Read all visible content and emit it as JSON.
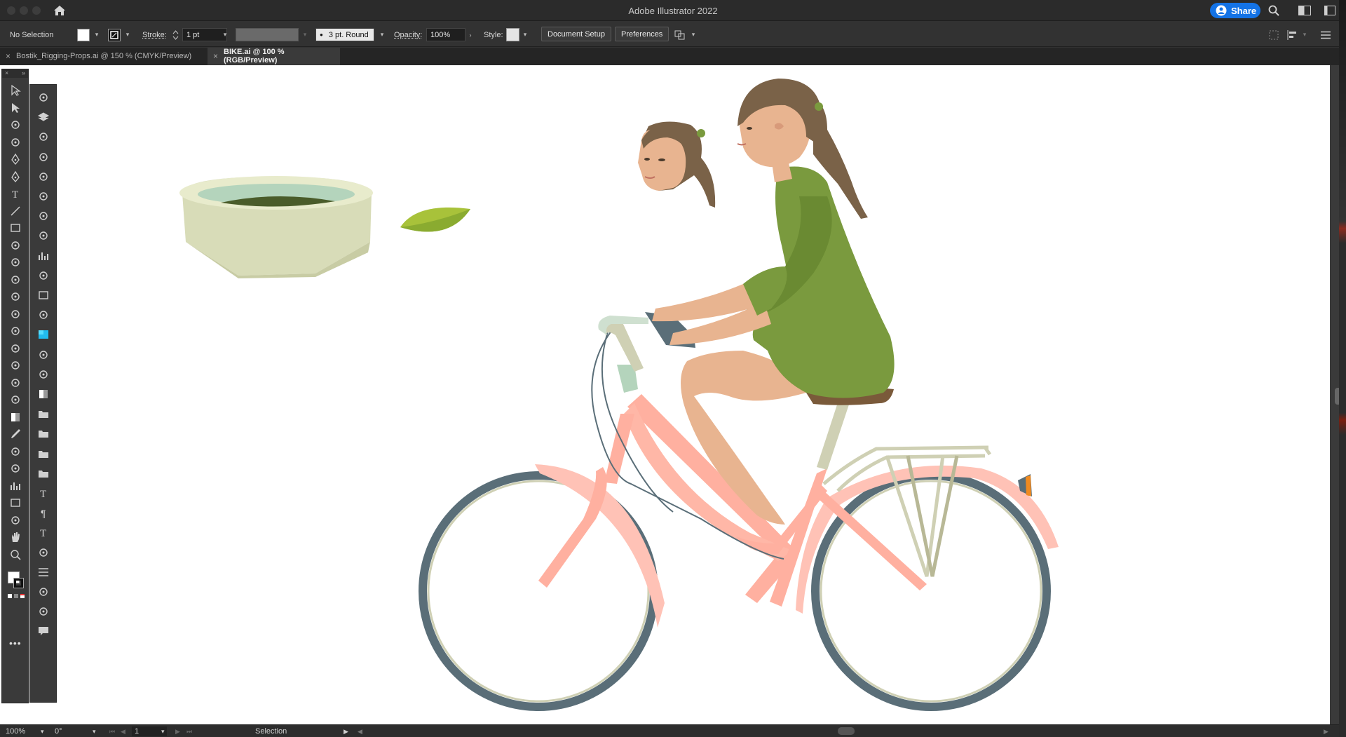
{
  "app": {
    "title": "Adobe Illustrator 2022",
    "share_label": "Share"
  },
  "control_bar": {
    "selection_status": "No Selection",
    "stroke_label": "Stroke:",
    "stroke_weight": "1 pt",
    "brush_label": "3 pt. Round",
    "opacity_label": "Opacity:",
    "opacity_value": "100%",
    "style_label": "Style:",
    "document_setup_label": "Document Setup",
    "preferences_label": "Preferences"
  },
  "tabs": [
    {
      "label": "Bostik_Rigging-Props.ai @ 150 % (CMYK/Preview)",
      "active": false
    },
    {
      "label": "BIKE.ai @ 100 % (RGB/Preview)",
      "active": true
    }
  ],
  "status_bar": {
    "zoom": "100%",
    "rotation": "0°",
    "artboard_number": "1",
    "current_tool": "Selection"
  },
  "toolbar": {
    "left_column_icons": [
      "selection-tool-icon",
      "direct-selection-tool-icon",
      "magic-wand-tool-icon",
      "lasso-tool-icon",
      "pen-tool-icon",
      "curvature-tool-icon",
      "type-tool-icon",
      "line-segment-tool-icon",
      "rectangle-tool-icon",
      "paintbrush-tool-icon",
      "shaper-tool-icon",
      "eraser-tool-icon",
      "rotate-tool-icon",
      "scale-tool-icon",
      "warp-tool-icon",
      "free-transform-tool-icon",
      "shape-builder-tool-icon",
      "perspective-grid-tool-icon",
      "mesh-tool-icon",
      "gradient-tool-icon",
      "eyedropper-tool-icon",
      "blend-tool-icon",
      "symbol-sprayer-tool-icon",
      "column-graph-tool-icon",
      "artboard-tool-icon",
      "slice-tool-icon",
      "hand-tool-icon",
      "zoom-tool-icon"
    ],
    "right_column_icons": [
      "transform-panel-icon",
      "layers-panel-icon",
      "libraries-panel-icon",
      "symbols-panel-icon",
      "export-panel-icon",
      "properties-panel-icon",
      "appearance-panel-icon",
      "align-panel-icon",
      "graphic-styles-panel-icon",
      "links-panel-icon",
      "artboards-panel-icon",
      "image-trace-panel-icon",
      "swatches-panel-icon",
      "color-guide-panel-icon",
      "brushes-panel-icon",
      "gradient-panel-icon",
      "folder-icon",
      "folder-icon",
      "folder-icon",
      "folder-icon",
      "character-panel-icon",
      "paragraph-panel-icon",
      "opentype-panel-icon",
      "puppet-warp-icon",
      "stroke-panel-icon",
      "pathfinder-panel-icon",
      "align-left-icon",
      "comments-panel-icon"
    ]
  },
  "colors": {
    "accent": "#1473e6",
    "frame_salmon": "#ffb0a0",
    "tire_slate": "#5a6e78",
    "dress_green": "#7a9a3e",
    "skin": "#e8b490",
    "hair": "#7a6248",
    "bowl": "#d8dcb8",
    "leaf": "#9cba3a"
  }
}
